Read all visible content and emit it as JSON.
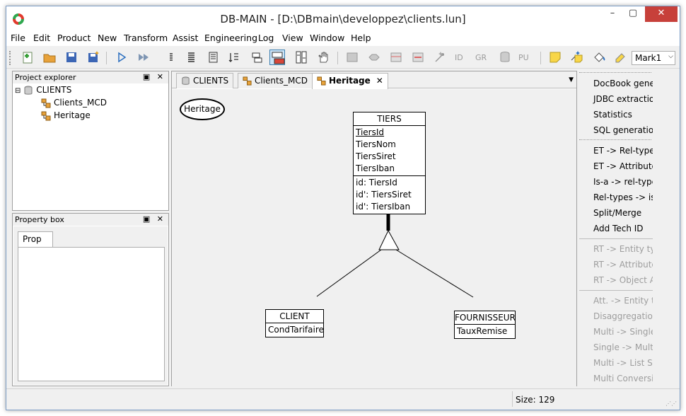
{
  "window": {
    "title": "DB-MAIN  - [D:\\DBmain\\developpez\\clients.lun]",
    "minimize": "–",
    "maximize": "▢",
    "close": "✕"
  },
  "menu": [
    {
      "label": "File"
    },
    {
      "label": "Edit"
    },
    {
      "label": "Product"
    },
    {
      "label": "New"
    },
    {
      "label": "Transform"
    },
    {
      "label": "Assist"
    },
    {
      "label": "Engineering"
    },
    {
      "label": "Log"
    },
    {
      "label": "View"
    },
    {
      "label": "Window"
    },
    {
      "label": "Help"
    }
  ],
  "toolbar": {
    "text_buttons": [
      "ID",
      "GR",
      "PU"
    ],
    "mark_select": "Mark1"
  },
  "project_explorer": {
    "title": "Project explorer",
    "controls": "▣ ✕",
    "expander": "⊟",
    "root": "CLIENTS",
    "children": [
      "Clients_MCD",
      "Heritage"
    ]
  },
  "property_box": {
    "title": "Property box",
    "controls": "▣ ✕",
    "tab": "Prop"
  },
  "doc_tabs": [
    {
      "label": "CLIENTS"
    },
    {
      "label": "Clients_MCD"
    },
    {
      "label": "Heritage"
    }
  ],
  "doc_tab_close": "✕",
  "doc_tab_menu": "▼",
  "diagram": {
    "schema_label": "Heritage",
    "tiers": {
      "name": "TIERS",
      "attributes": [
        "TiersId",
        "TiersNom",
        "TiersSiret",
        "TiersIban"
      ],
      "identifiers": [
        "id: TiersId",
        "id': TiersSiret",
        "id': TiersIban"
      ]
    },
    "client": {
      "name": "CLIENT",
      "attributes": [
        "CondTarifaire"
      ]
    },
    "fournisseur": {
      "name": "FOURNISSEUR",
      "attributes": [
        "TauxRemise"
      ]
    }
  },
  "side_panel": {
    "group1": [
      "DocBook generation",
      "JDBC extraction",
      "Statistics",
      "SQL generation"
    ],
    "group2": [
      "ET -> Rel-type",
      "ET -> Attribute",
      "Is-a -> rel-types",
      "Rel-types -> is-a",
      "Split/Merge",
      "Add Tech ID"
    ],
    "group3": [
      "RT -> Entity typ",
      "RT -> Attribute",
      "RT -> Object Att"
    ],
    "group4": [
      "Att. -> Entity typ",
      "Disaggregation",
      "Multi -> Single",
      "Single -> Multi",
      "Multi -> List Sin",
      "Multi Conversio"
    ]
  },
  "status": {
    "size": "Size: 129"
  }
}
